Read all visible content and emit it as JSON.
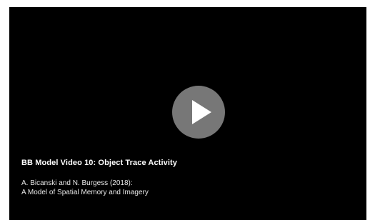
{
  "video": {
    "title": "BB Model Video 10: Object Trace Activity",
    "citation_line1": "A. Bicanski and N. Burgess (2018):",
    "citation_line2": "A Model of Spatial Memory and Imagery",
    "play_icon": "play-icon",
    "background_color": "#000000",
    "play_button_color": "#8c8c8c"
  }
}
